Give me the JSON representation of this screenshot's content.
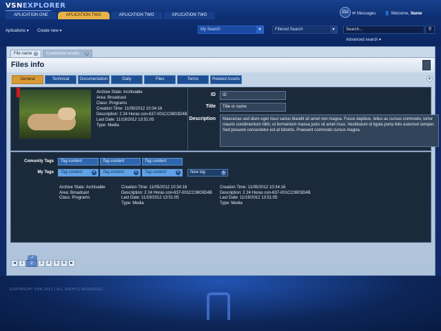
{
  "app": {
    "logo_main": "VSN",
    "logo_sub": "EXPLORER",
    "tabs": [
      "APLICATION ONE",
      "APLICATION TWO",
      "APLICATION TWO",
      "APLICATION TWO"
    ],
    "active_tab": 1,
    "notification_count": "252",
    "messages_label": "Messages",
    "welcome_label": "Welcome,",
    "user_name": "Name"
  },
  "toolbar": {
    "aplications_label": "Aplications",
    "create_new_label": "Create new",
    "my_search_value": "My Search",
    "filtered_search_value": "Filtered Search",
    "search_placeholder": "Search...",
    "advanced_search_label": "Advanced search"
  },
  "doc_tabs": [
    {
      "label": "File name"
    },
    {
      "label": "Customize results..."
    }
  ],
  "page": {
    "title": "Files info"
  },
  "sub_tabs": [
    "General",
    "Technical",
    "Documentation",
    "Daily",
    "Files",
    "Terms",
    "Related Assets"
  ],
  "info": {
    "meta": [
      "Archive State: Archivable",
      "Area: Broadcast",
      "Class: Programs",
      "Creation Time: 11/05/2012 10:34:16",
      "Description: 2 24 Horas con-637-001CC0803D4B",
      "Last Date: 11/19/2012 13:51:05",
      "Type: Media"
    ],
    "id_label": "ID",
    "id_value": "ID",
    "title_label": "Title",
    "title_value": "Title or name",
    "description_label": "Description",
    "description_value": "Maecenas sed diam eget risus varius blandit sit amet non magna. Fusce dapibus, tellus ac cursus commodo, tortor mauris condimentum nibh, ut fermentum massa justo sit amet risus. Vestibulum id ligula porta felis euismod semper. Sed posuere consectetur est at lobortis. Praesent commodo cursus magna."
  },
  "tags": {
    "community_label": "Comunity Tags",
    "my_label": "My Tags",
    "community": [
      "Tag content",
      "Tag content",
      "Tag content"
    ],
    "mine": [
      "Tag content",
      "Tag content",
      "Tag content"
    ],
    "new_tag": "New tag",
    "columns": [
      [
        "Archive State: Archivable",
        "Area: Broadcast",
        "Class: Programs"
      ],
      [
        "Creation Time: 11/05/2012 10:34:16",
        "Description: 2 24 Horas con-637-001CC0803D4B",
        "Last Date: 11/19/2012 13:51:05",
        "Type: Media"
      ],
      [
        "Creation Time: 11/05/2012 10:34:16",
        "Description: 2 24 Horas con-637-001CC0803D4B",
        "Last Date: 11/19/2012 13:51:05",
        "Type: Media"
      ]
    ]
  },
  "pager": {
    "prev": "◄",
    "next": "►",
    "pages": [
      "1",
      "2",
      "3",
      "4",
      "5",
      "6"
    ],
    "current": "2"
  },
  "footer": {
    "text": "COPYRIGHT VSN 2012 | ALL RIGHTS RESERVED"
  }
}
